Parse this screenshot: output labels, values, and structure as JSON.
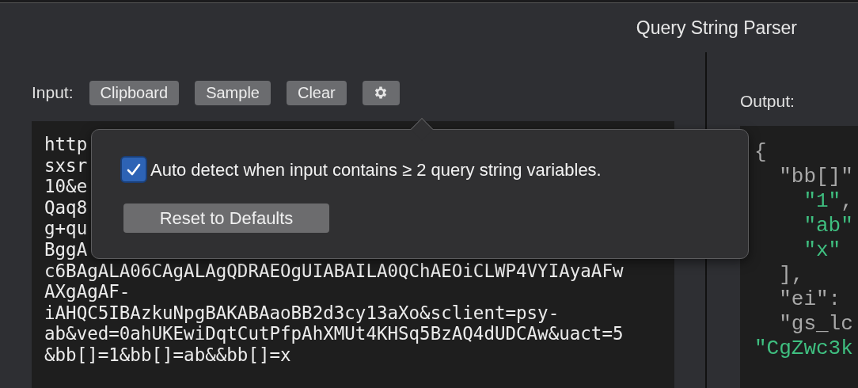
{
  "window": {
    "title": "Query String Parser"
  },
  "input": {
    "label": "Input:",
    "buttons": [
      {
        "label": "Clipboard",
        "kind": "text"
      },
      {
        "label": "Sample",
        "kind": "text"
      },
      {
        "label": "Clear",
        "kind": "text"
      },
      {
        "kind": "settings"
      }
    ],
    "lines": [
      "http",
      "sxsr",
      "10&e",
      "Qaq8",
      "g+qu",
      "BggA",
      "c6BAgALA06CAgALAgQDRAEOgUIABAILA0QChAEOiCLWP4VYIAyaAFw",
      "AXgAgAF-",
      "iAHQC5IBAzkuNpgBAKABAaoBB2d3cy13aXo&sclient=psy-",
      "ab&ved=0ahUKEwiDqtCutPfpAhXMUt4KHSq5BzAQ4dUDCAw&uact=5",
      "&bb[]=1&bb[]=ab&&bb[]=x"
    ]
  },
  "popover": {
    "checkbox": {
      "label": "Auto detect when input contains ≥ 2 query string variables.",
      "checked": true
    },
    "reset_button": "Reset to Defaults"
  },
  "output": {
    "label": "Output:",
    "lines": [
      [
        {
          "text": "{",
          "kind": "punct"
        }
      ],
      [
        {
          "text": "  \"bb[]\"",
          "kind": "key"
        }
      ],
      [
        {
          "text": "    \"1\"",
          "kind": "string"
        },
        {
          "text": ",",
          "kind": "punct"
        }
      ],
      [
        {
          "text": "    \"ab\"",
          "kind": "string"
        }
      ],
      [
        {
          "text": "    \"x\"",
          "kind": "string"
        }
      ],
      [
        {
          "text": "  ],",
          "kind": "punct"
        }
      ],
      [
        {
          "text": "  \"ei\":",
          "kind": "key"
        }
      ],
      [
        {
          "text": "  \"gs_lc",
          "kind": "key"
        }
      ],
      [
        {
          "text": "\"CgZwc3k",
          "kind": "string"
        }
      ]
    ]
  }
}
